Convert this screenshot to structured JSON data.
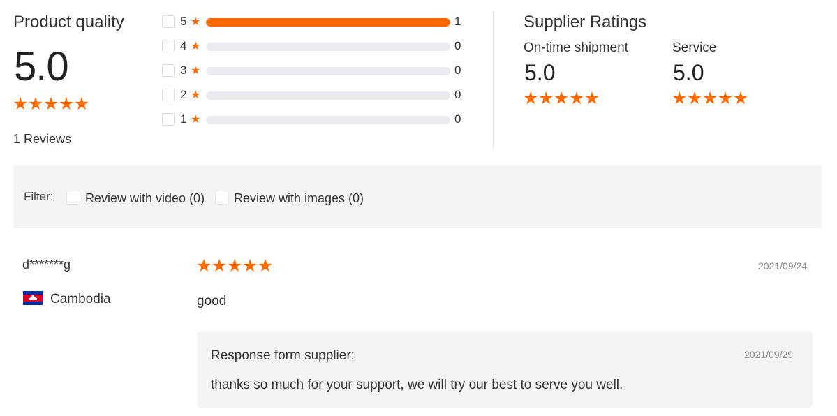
{
  "product_quality": {
    "title": "Product quality",
    "score": "5.0",
    "stars": 5,
    "reviews_text": "1 Reviews"
  },
  "breakdown": [
    {
      "rating": "5",
      "count": "1",
      "fraction": 1.0
    },
    {
      "rating": "4",
      "count": "0",
      "fraction": 0
    },
    {
      "rating": "3",
      "count": "0",
      "fraction": 0
    },
    {
      "rating": "2",
      "count": "0",
      "fraction": 0
    },
    {
      "rating": "1",
      "count": "0",
      "fraction": 0
    }
  ],
  "supplier_ratings": {
    "title": "Supplier Ratings",
    "items": [
      {
        "label": "On-time shipment",
        "score": "5.0",
        "stars": 5
      },
      {
        "label": "Service",
        "score": "5.0",
        "stars": 5
      }
    ]
  },
  "filter": {
    "label": "Filter:",
    "options": [
      {
        "label": "Review with video (0)",
        "checked": false
      },
      {
        "label": "Review with images (0)",
        "checked": false
      }
    ]
  },
  "review": {
    "reviewer": "d*******g",
    "country": "Cambodia",
    "flag_icon": "cambodia-flag-icon",
    "stars": 5,
    "date": "2021/09/24",
    "text": "good",
    "response": {
      "title": "Response form supplier:",
      "date": "2021/09/29",
      "text": "thanks so much for your support, we will try our best to serve you well."
    }
  },
  "colors": {
    "accent": "#ff6a00",
    "track": "#ebecf0",
    "panel": "#f4f4f4"
  }
}
